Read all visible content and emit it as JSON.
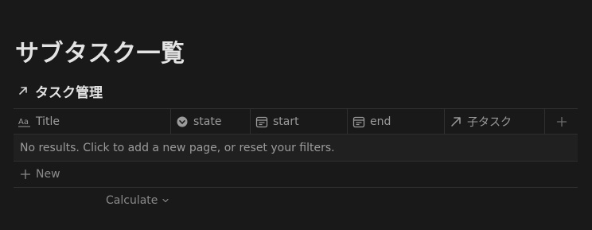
{
  "page": {
    "title": "サブタスク一覧"
  },
  "database": {
    "title": "タスク管理",
    "link_icon": "arrow-up-right-icon"
  },
  "table": {
    "columns": [
      {
        "label": "Title",
        "icon": "text-aa-icon"
      },
      {
        "label": "state",
        "icon": "status-icon"
      },
      {
        "label": "start",
        "icon": "calendar-icon"
      },
      {
        "label": "end",
        "icon": "calendar-icon"
      },
      {
        "label": "子タスク",
        "icon": "arrow-up-right-icon"
      }
    ],
    "add_column_icon": "plus-icon",
    "empty_message": "No results. Click to add a new page, or reset your filters.",
    "new_label": "New",
    "calculate_label": "Calculate"
  },
  "colors": {
    "background": "#191919",
    "text": "#d4d4d4",
    "muted": "#9b9b9b",
    "border": "#2f2f2f"
  }
}
